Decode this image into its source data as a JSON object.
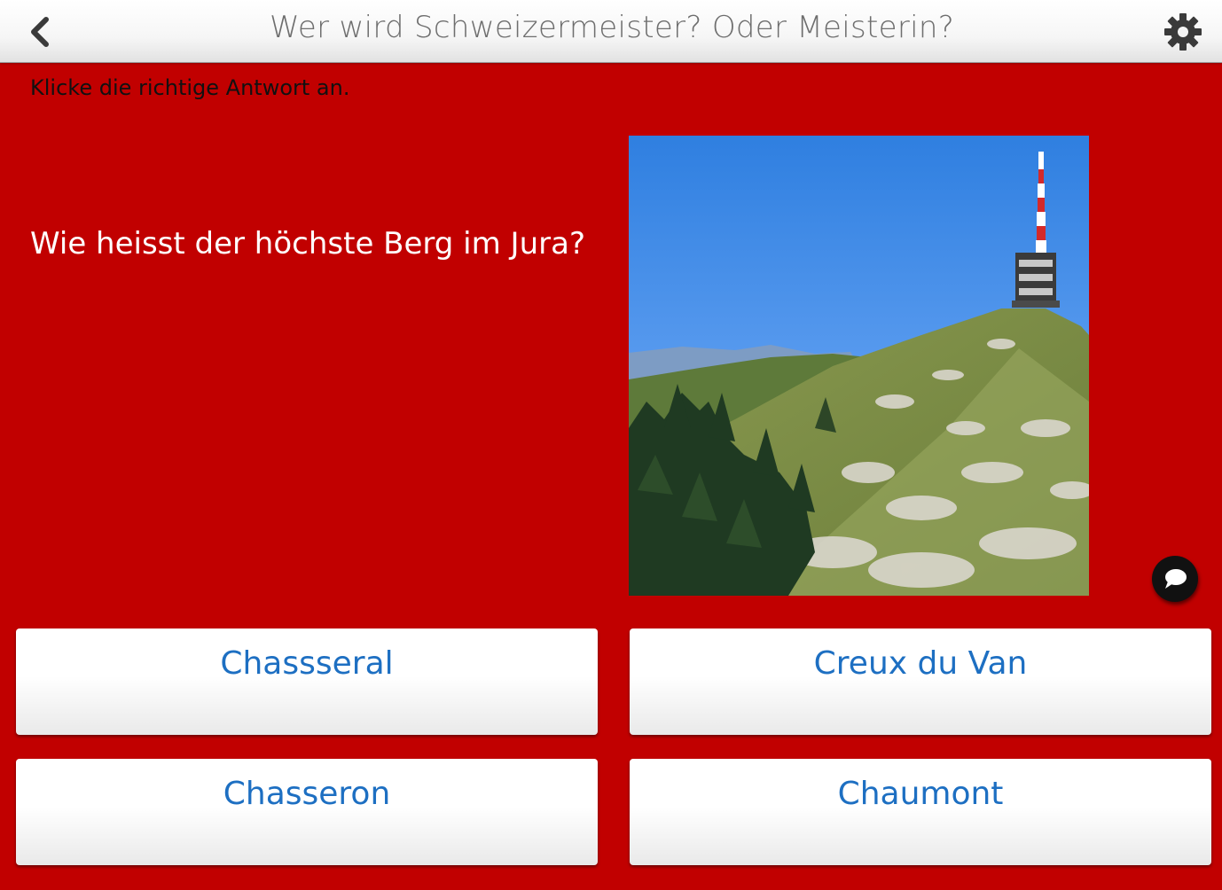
{
  "header": {
    "title": "Wer wird Schweizermeister? Oder Meisterin?",
    "back_icon": "chevron-left-icon",
    "settings_icon": "gear-icon"
  },
  "quiz": {
    "instruction": "Klicke die richtige Antwort an.",
    "question": "Wie heisst der höchste Berg im Jura?",
    "image": "photo of a grassy mountain ridge with a red-and-white telecommunication tower",
    "comment_icon": "speech-bubble-icon",
    "answers": [
      {
        "label": "Chassseral"
      },
      {
        "label": "Creux du Van"
      },
      {
        "label": "Chasseron"
      },
      {
        "label": "Chaumont"
      }
    ]
  },
  "colors": {
    "background": "#c10000",
    "answer_text": "#1d6fc2",
    "title_text": "#6e6e6e"
  }
}
